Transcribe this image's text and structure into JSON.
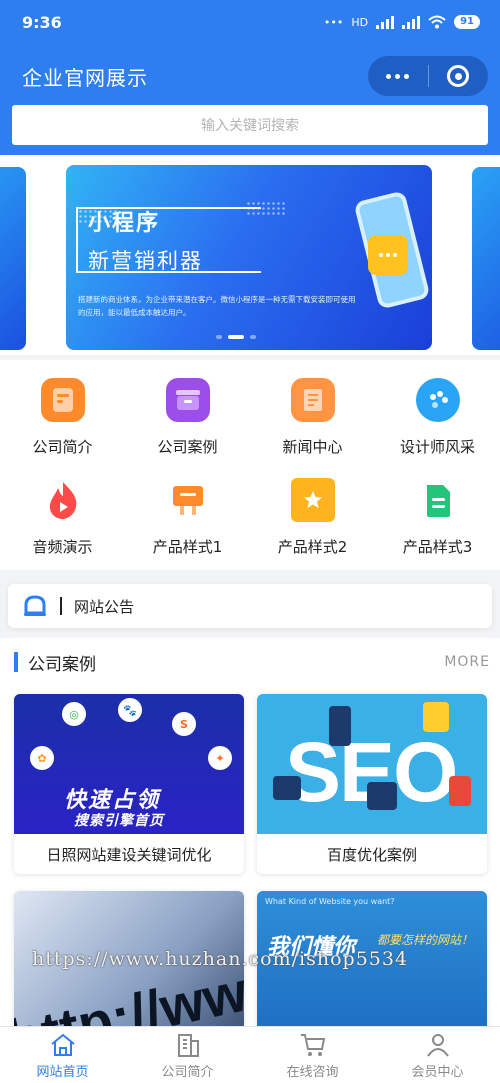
{
  "status_bar": {
    "time": "9:36",
    "network": "HD",
    "battery": "91"
  },
  "nav": {
    "title": "企业官网展示"
  },
  "search": {
    "placeholder": "输入关键词搜索"
  },
  "banner": {
    "title_line1": "小程序",
    "title_line2": "新营销利器",
    "description": "搭建新的商业体系，为企业带来潜在客户。微信小程序是一种无需下载安装即可使用的应用，能以最低成本触达用户。",
    "active_slide": 2,
    "slide_count": 3
  },
  "grid": {
    "items": [
      {
        "label": "公司简介",
        "icon": "document-icon",
        "color": "#ff8a2b"
      },
      {
        "label": "公司案例",
        "icon": "archive-box-icon",
        "color": "#9b4fe8"
      },
      {
        "label": "新闻中心",
        "icon": "scroll-icon",
        "color": "#ff9443"
      },
      {
        "label": "设计师风采",
        "icon": "palette-icon",
        "color": "#2aa4f4"
      },
      {
        "label": "音频演示",
        "icon": "flame-icon",
        "color": "#ff4a4a"
      },
      {
        "label": "产品样式1",
        "icon": "easel-icon",
        "color": "#ff8a2b"
      },
      {
        "label": "产品样式2",
        "icon": "star-badge-icon",
        "color": "#ffb41f"
      },
      {
        "label": "产品样式3",
        "icon": "file-list-icon",
        "color": "#22c57a"
      }
    ]
  },
  "notice": {
    "label": "网站公告"
  },
  "cases": {
    "title": "公司案例",
    "more": "MORE",
    "cards": [
      {
        "caption": "日照网站建设关键词优化",
        "img_title": "快速占领",
        "img_subtitle": "搜索引擎首页"
      },
      {
        "caption": "百度优化案例",
        "img_title": "SEO"
      },
      {
        "caption": "",
        "img_title": "http://ww"
      },
      {
        "caption": "",
        "img_question": "What Kind of Website you want?",
        "img_title": "我们懂你",
        "img_subtitle": "都要怎样的网站！"
      }
    ]
  },
  "watermark": "https://www.huzhan.com/ishop5534",
  "tabbar": {
    "tabs": [
      {
        "label": "网站首页",
        "icon": "home-icon",
        "active": true
      },
      {
        "label": "公司简介",
        "icon": "building-icon",
        "active": false
      },
      {
        "label": "在线咨询",
        "icon": "cart-icon",
        "active": false
      },
      {
        "label": "会员中心",
        "icon": "user-icon",
        "active": false
      }
    ]
  },
  "colors": {
    "primary": "#2e7ef0",
    "capsule": "#1f5fc4",
    "muted": "#999999"
  }
}
